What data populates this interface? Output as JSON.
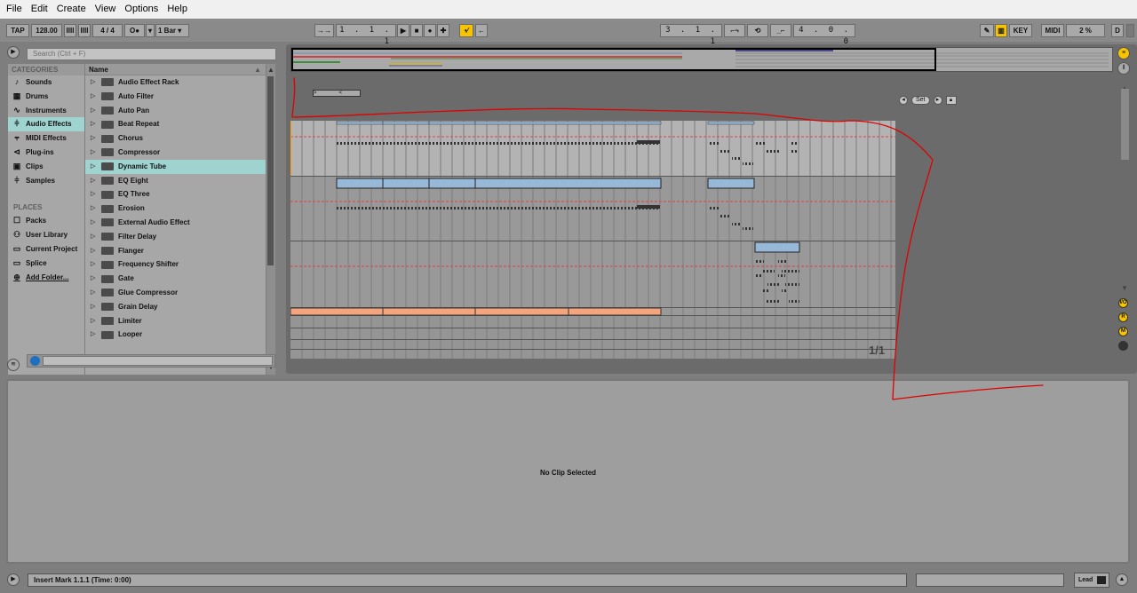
{
  "menu": [
    "File",
    "Edit",
    "Create",
    "View",
    "Options",
    "Help"
  ],
  "control_bar": {
    "tap": "TAP",
    "tempo": "128.00",
    "nudge_down": "IIII",
    "nudge_up": "IIII",
    "time_signature": "4 / 4",
    "metronome": "O●",
    "metronome_arrow": "▾",
    "quantization": "1 Bar",
    "quantization_arrow": "▾",
    "follow": "→→",
    "song_position": "1 . 1 . 1",
    "loop_start": "3 . 1 . 1",
    "loop_length": "4 . 0 . 0",
    "key": "KEY",
    "midi": "MIDI",
    "cpu": "2 %",
    "d": "D"
  },
  "browser": {
    "search_placeholder": "Search (Ctrl + F)",
    "categories_heading": "CATEGORIES",
    "categories": [
      {
        "label": "Sounds",
        "icon": "note-icon"
      },
      {
        "label": "Drums",
        "icon": "drum-grid-icon"
      },
      {
        "label": "Instruments",
        "icon": "instrument-wave-icon"
      },
      {
        "label": "Audio Effects",
        "icon": "audio-effects-icon",
        "selected": true
      },
      {
        "label": "MIDI Effects",
        "icon": "midi-effects-icon"
      },
      {
        "label": "Plug-ins",
        "icon": "plugin-icon"
      },
      {
        "label": "Clips",
        "icon": "clip-icon"
      },
      {
        "label": "Samples",
        "icon": "sample-wave-icon"
      }
    ],
    "places_heading": "PLACES",
    "places": [
      {
        "label": "Packs",
        "icon": "packs-icon"
      },
      {
        "label": "User Library",
        "icon": "user-icon"
      },
      {
        "label": "Current Project",
        "icon": "project-icon"
      },
      {
        "label": "Splice",
        "icon": "folder-icon"
      },
      {
        "label": "Add Folder...",
        "icon": "add-folder-icon"
      }
    ],
    "name_column": "Name",
    "items": [
      "Audio Effect Rack",
      "Auto Filter",
      "Auto Pan",
      "Beat Repeat",
      "Chorus",
      "Compressor",
      "Dynamic Tube",
      "EQ Eight",
      "EQ Three",
      "Erosion",
      "External Audio Effect",
      "Filter Delay",
      "Flanger",
      "Frequency Shifter",
      "Gate",
      "Glue Compressor",
      "Grain Delay",
      "Limiter",
      "Looper"
    ],
    "selected_item": "Dynamic Tube"
  },
  "arrangement": {
    "set_label": "Set",
    "page_indicator": "1/1",
    "side_dots": [
      "I/O",
      "R",
      "M"
    ]
  },
  "detail": {
    "message": "No Clip Selected"
  },
  "status": {
    "message": "Insert Mark 1.1.1 (Time: 0:00)",
    "lead": "Lead"
  },
  "colors": {
    "accent_yellow": "#f6c500",
    "selection_teal": "#9ed3d0",
    "clip_blue": "#98b8d8",
    "clip_orange": "#f4a57d",
    "annotation_red": "#e00000"
  }
}
